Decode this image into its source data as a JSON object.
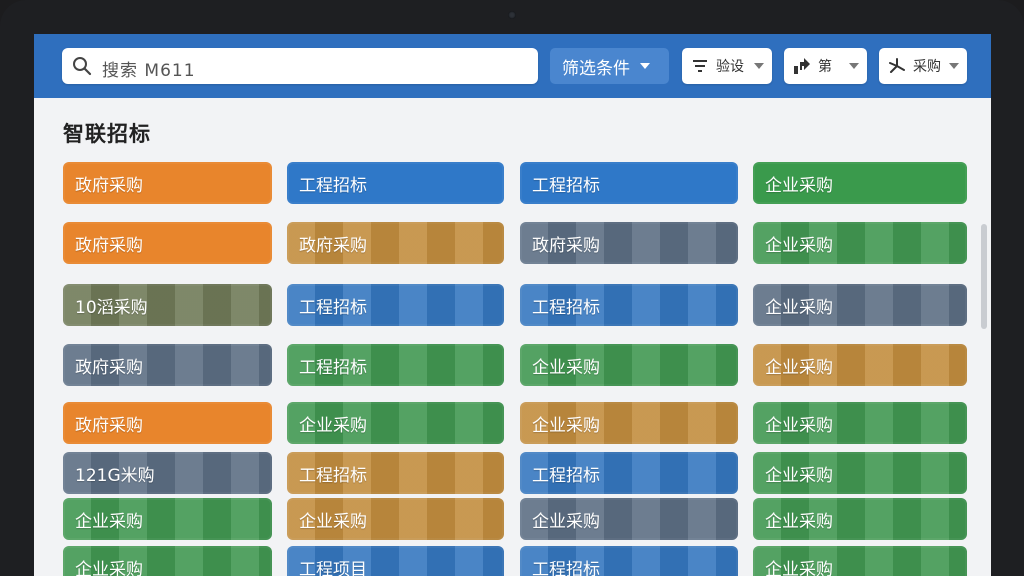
{
  "search": {
    "placeholder": "搜索 M611"
  },
  "toolbar": {
    "filter_label": "筛选条件",
    "dropdowns": [
      {
        "label": "验设",
        "icon": "filter-lines-icon"
      },
      {
        "label": "第",
        "icon": "chart-arrow-icon"
      },
      {
        "label": "采购",
        "icon": "star-burst-icon"
      }
    ]
  },
  "section": {
    "title": "智联招标"
  },
  "colors": {
    "orange": "#e8852c",
    "blue": "#2f78c8",
    "green": "#3a9a4c",
    "olive": "#6f7a55",
    "gold": "#c88c35",
    "slate": "#5a6e86"
  },
  "tags": [
    [
      "政府采购",
      "工程招标",
      "工程招标",
      "企业采购"
    ],
    [
      "政府采购",
      "政府采购",
      "政府采购",
      "企业采购"
    ],
    [
      "10滔采购",
      "工程招标",
      "工程招标",
      "企业采购"
    ],
    [
      "政府采购",
      "工程招标",
      "企业采购",
      "企业采购"
    ],
    [
      "政府采购",
      "企业采购",
      "企业采购",
      "企业采购"
    ],
    [
      "121G米购",
      "工程招标",
      "工程招标",
      "企业采购"
    ],
    [
      "企业采购",
      "企业采购",
      "企业采购",
      "企业采购"
    ],
    [
      "企业采购",
      "工程项目",
      "工程招标",
      "企业采购"
    ]
  ],
  "tag_colors": [
    [
      "orange",
      "blue",
      "blue",
      "green"
    ],
    [
      "orange",
      "gold",
      "slate",
      "green"
    ],
    [
      "olive",
      "blue",
      "blue",
      "slate"
    ],
    [
      "slate",
      "green",
      "green",
      "gold"
    ],
    [
      "orange",
      "green",
      "gold",
      "green"
    ],
    [
      "slate",
      "gold",
      "blue",
      "green"
    ],
    [
      "green",
      "gold",
      "slate",
      "green"
    ],
    [
      "green",
      "blue",
      "blue",
      "green"
    ]
  ]
}
